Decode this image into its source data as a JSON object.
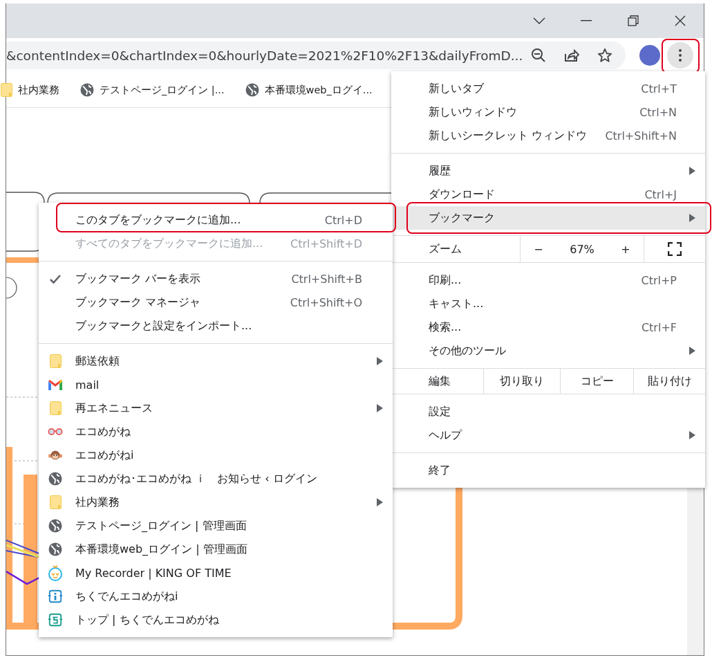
{
  "toolbar": {
    "address": "&contentIndex=0&chartIndex=0&hourlyDate=2021%2F10%2F13&dailyFromD...",
    "menu_button": {
      "highlighted": true
    }
  },
  "bookmarks_bar": [
    {
      "kind": "folder",
      "label": "社内業務"
    },
    {
      "kind": "globe",
      "label": "テストページ_ログイン |..."
    },
    {
      "kind": "globe",
      "label": "本番環境web_ログイ..."
    }
  ],
  "main_menu": {
    "sections": [
      [
        {
          "kind": "item",
          "label": "新しいタブ",
          "shortcut": "Ctrl+T",
          "submenu": false,
          "selected": false,
          "highlighted": false
        },
        {
          "kind": "item",
          "label": "新しいウィンドウ",
          "shortcut": "Ctrl+N",
          "submenu": false,
          "selected": false,
          "highlighted": false
        },
        {
          "kind": "item",
          "label": "新しいシークレット ウィンドウ",
          "shortcut": "Ctrl+Shift+N",
          "submenu": false,
          "selected": false,
          "highlighted": false
        }
      ],
      [
        {
          "kind": "item",
          "label": "履歴",
          "submenu": true,
          "selected": false,
          "highlighted": false
        },
        {
          "kind": "item",
          "label": "ダウンロード",
          "shortcut": "Ctrl+J",
          "submenu": false,
          "selected": false,
          "highlighted": false
        },
        {
          "kind": "item",
          "label": "ブックマーク",
          "submenu": true,
          "selected": true,
          "highlighted": true
        }
      ],
      [
        {
          "kind": "zoom",
          "label": "ズーム",
          "minus": "−",
          "value": "67%",
          "plus": "+"
        }
      ],
      [
        {
          "kind": "item",
          "label": "印刷...",
          "shortcut": "Ctrl+P",
          "submenu": false,
          "selected": false,
          "highlighted": false
        },
        {
          "kind": "item",
          "label": "キャスト...",
          "submenu": false,
          "selected": false,
          "highlighted": false
        },
        {
          "kind": "item",
          "label": "検索...",
          "shortcut": "Ctrl+F",
          "submenu": false,
          "selected": false,
          "highlighted": false
        },
        {
          "kind": "item",
          "label": "その他のツール",
          "submenu": true,
          "selected": false,
          "highlighted": false
        }
      ],
      [
        {
          "kind": "edit",
          "label": "編集",
          "actions": [
            "切り取り",
            "コピー",
            "貼り付け"
          ]
        }
      ],
      [
        {
          "kind": "item",
          "label": "設定",
          "submenu": false,
          "selected": false,
          "highlighted": false
        },
        {
          "kind": "item",
          "label": "ヘルプ",
          "submenu": true,
          "selected": false,
          "highlighted": false
        }
      ],
      [
        {
          "kind": "item",
          "label": "終了",
          "submenu": false,
          "selected": false,
          "highlighted": false
        }
      ]
    ]
  },
  "bookmarks_menu": {
    "sections": [
      [
        {
          "kind": "command",
          "label": "このタブをブックマークに追加...",
          "shortcut": "Ctrl+D",
          "checked": false,
          "disabled": false,
          "highlighted": true,
          "submenu": false
        },
        {
          "kind": "command",
          "label": "すべてのタブをブックマークに追加...",
          "shortcut": "Ctrl+Shift+D",
          "checked": false,
          "disabled": true,
          "highlighted": false,
          "submenu": false
        }
      ],
      [
        {
          "kind": "command",
          "label": "ブックマーク バーを表示",
          "shortcut": "Ctrl+Shift+B",
          "checked": true,
          "disabled": false,
          "highlighted": false,
          "submenu": false
        },
        {
          "kind": "command",
          "label": "ブックマーク マネージャ",
          "shortcut": "Ctrl+Shift+O",
          "checked": false,
          "disabled": false,
          "highlighted": false,
          "submenu": false
        },
        {
          "kind": "command",
          "label": "ブックマークと設定をインポート...",
          "checked": false,
          "disabled": false,
          "highlighted": false,
          "submenu": false
        }
      ],
      [
        {
          "kind": "folder",
          "label": "郵送依頼",
          "disabled": false,
          "highlighted": false,
          "submenu": true
        },
        {
          "kind": "gmail",
          "label": "mail",
          "disabled": false,
          "highlighted": false,
          "submenu": false
        },
        {
          "kind": "folder",
          "label": "再エネニュース",
          "disabled": false,
          "highlighted": false,
          "submenu": true
        },
        {
          "kind": "glasses",
          "label": "エコめがね",
          "disabled": false,
          "highlighted": false,
          "submenu": false
        },
        {
          "kind": "monkey",
          "label": "エコめがねi",
          "disabled": false,
          "highlighted": false,
          "submenu": false
        },
        {
          "kind": "globe",
          "label": "エコめがね･エコめがね ｉ　お知らせ ‹ ログイン",
          "disabled": false,
          "highlighted": false,
          "submenu": false
        },
        {
          "kind": "folder",
          "label": "社内業務",
          "disabled": false,
          "highlighted": false,
          "submenu": true
        },
        {
          "kind": "globe",
          "label": "テストページ_ログイン | 管理画面",
          "disabled": false,
          "highlighted": false,
          "submenu": false
        },
        {
          "kind": "globe",
          "label": "本番環境web_ログイン | 管理画面",
          "disabled": false,
          "highlighted": false,
          "submenu": false
        },
        {
          "kind": "timer",
          "label": "My Recorder | KING OF TIME",
          "disabled": false,
          "highlighted": false,
          "submenu": false
        },
        {
          "kind": "info",
          "label": "ちくでんエコめがねi",
          "disabled": false,
          "highlighted": false,
          "submenu": false
        },
        {
          "kind": "top",
          "label": "トップ | ちくでんエコめがね",
          "disabled": false,
          "highlighted": false,
          "submenu": false
        }
      ]
    ]
  }
}
